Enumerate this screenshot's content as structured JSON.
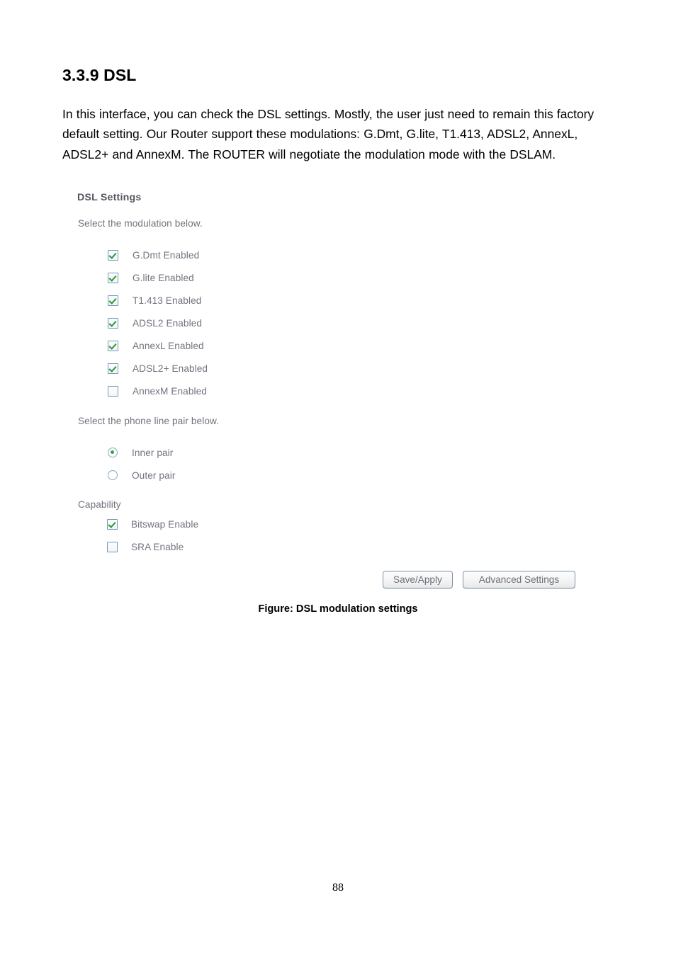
{
  "document": {
    "heading": "3.3.9 DSL",
    "paragraph": "In this interface, you can check the DSL settings. Mostly, the user just need to remain this factory default setting. Our Router support these modulations: G.Dmt, G.lite, T1.413, ADSL2, AnnexL, ADSL2+ and AnnexM. The ROUTER will negotiate the modulation mode with the DSLAM.",
    "figure_caption": "Figure: DSL modulation settings",
    "page_number": "88"
  },
  "router_ui": {
    "title": "DSL Settings",
    "modulation_prompt": "Select the modulation below.",
    "modulations": [
      {
        "label": "G.Dmt Enabled",
        "checked": true
      },
      {
        "label": "G.lite Enabled",
        "checked": true
      },
      {
        "label": "T1.413 Enabled",
        "checked": true
      },
      {
        "label": "ADSL2 Enabled",
        "checked": true
      },
      {
        "label": "AnnexL Enabled",
        "checked": true
      },
      {
        "label": "ADSL2+ Enabled",
        "checked": true
      },
      {
        "label": "AnnexM Enabled",
        "checked": false
      }
    ],
    "linepair_prompt": "Select the phone line pair below.",
    "linepairs": [
      {
        "label": "Inner pair",
        "selected": true
      },
      {
        "label": "Outer pair",
        "selected": false
      }
    ],
    "capability_label": "Capability",
    "capabilities": [
      {
        "label": "Bitswap Enable",
        "checked": true
      },
      {
        "label": "SRA Enable",
        "checked": false
      }
    ],
    "buttons": {
      "save_apply": "Save/Apply",
      "advanced_settings": "Advanced Settings"
    },
    "colors": {
      "label_text": "#72727e",
      "title_text": "#55555f",
      "check_green": "#1f9c36",
      "radio_green": "#2bab3c",
      "control_border": "#7996b8",
      "button_border": "#7e93ad"
    }
  }
}
